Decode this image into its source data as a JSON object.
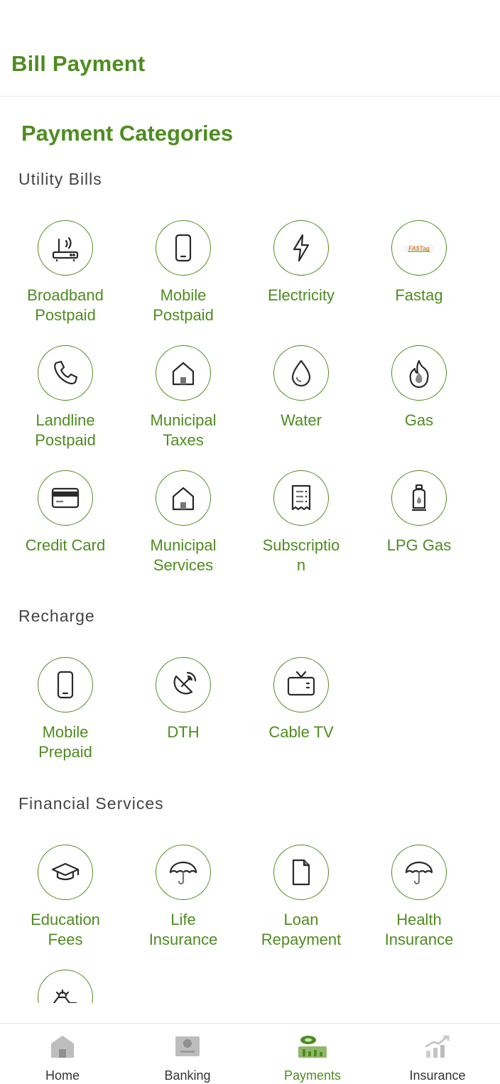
{
  "header": {
    "title": "Bill Payment"
  },
  "page": {
    "heading": "Payment Categories"
  },
  "sections": {
    "utility": {
      "title": "Utility Bills",
      "items": [
        {
          "label": "Broadband\nPostpaid",
          "icon": "router-icon"
        },
        {
          "label": "Mobile\nPostpaid",
          "icon": "mobile-icon"
        },
        {
          "label": "Electricity",
          "icon": "lightning-icon"
        },
        {
          "label": "Fastag",
          "icon": "fastag-logo"
        },
        {
          "label": "Landline\nPostpaid",
          "icon": "phone-icon"
        },
        {
          "label": "Municipal\nTaxes",
          "icon": "house-icon"
        },
        {
          "label": "Water",
          "icon": "water-drop-icon"
        },
        {
          "label": "Gas",
          "icon": "gas-flame-icon"
        },
        {
          "label": "Credit Card",
          "icon": "credit-card-icon"
        },
        {
          "label": "Municipal\nServices",
          "icon": "house-icon"
        },
        {
          "label": "Subscriptio\nn",
          "icon": "receipt-icon"
        },
        {
          "label": "LPG Gas",
          "icon": "gas-cylinder-icon"
        }
      ]
    },
    "recharge": {
      "title": "Recharge",
      "items": [
        {
          "label": "Mobile\nPrepaid",
          "icon": "mobile-icon"
        },
        {
          "label": "DTH",
          "icon": "satellite-dish-icon"
        },
        {
          "label": "Cable TV",
          "icon": "tv-icon"
        }
      ]
    },
    "financial": {
      "title": "Financial Services",
      "items": [
        {
          "label": "Education\nFees",
          "icon": "graduation-cap-icon"
        },
        {
          "label": "Life\nInsurance",
          "icon": "umbrella-icon"
        },
        {
          "label": "Loan\nRepayment",
          "icon": "document-icon"
        },
        {
          "label": "Health\nInsurance",
          "icon": "umbrella-icon"
        },
        {
          "label": "",
          "icon": "vehicle-insurance-icon"
        }
      ]
    }
  },
  "fastag_logo_text": "FASTag",
  "nav": {
    "items": [
      {
        "label": "Home",
        "icon": "home-icon",
        "active": false
      },
      {
        "label": "Banking",
        "icon": "bank-icon",
        "active": false
      },
      {
        "label": "Payments",
        "icon": "payments-icon",
        "active": true
      },
      {
        "label": "Insurance",
        "icon": "insurance-icon",
        "active": false
      }
    ]
  },
  "colors": {
    "accent": "#4e8c1f",
    "icon": "#2a2a2a",
    "muted": "#9e9e9e"
  }
}
